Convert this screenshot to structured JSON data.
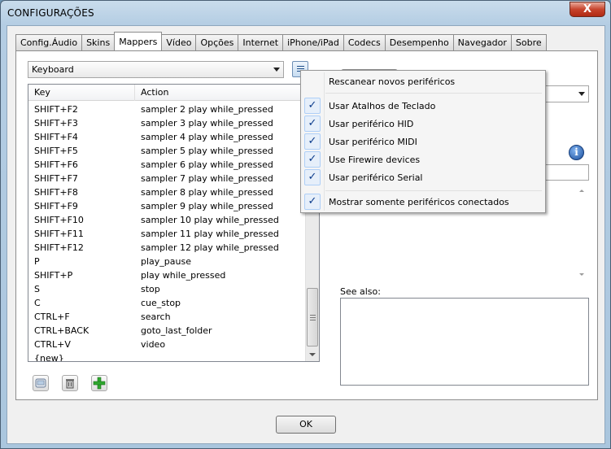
{
  "window": {
    "title": "CONFIGURAÇÕES",
    "close_symbol": "X"
  },
  "tabs": [
    "Config.Áudio",
    "Skins",
    "Mappers",
    "Vídeo",
    "Opções",
    "Internet",
    "iPhone/iPad",
    "Codecs",
    "Desempenho",
    "Navegador",
    "Sobre"
  ],
  "active_tab": "Mappers",
  "mapper_combo": {
    "value": "Keyboard"
  },
  "list": {
    "columns": {
      "key": "Key",
      "action": "Action"
    },
    "rows": [
      {
        "key": "SHIFT+F2",
        "action": "sampler 2 play while_pressed"
      },
      {
        "key": "SHIFT+F3",
        "action": "sampler 3 play while_pressed"
      },
      {
        "key": "SHIFT+F4",
        "action": "sampler 4 play while_pressed"
      },
      {
        "key": "SHIFT+F5",
        "action": "sampler 5 play while_pressed"
      },
      {
        "key": "SHIFT+F6",
        "action": "sampler 6 play while_pressed"
      },
      {
        "key": "SHIFT+F7",
        "action": "sampler 7 play while_pressed"
      },
      {
        "key": "SHIFT+F8",
        "action": "sampler 8 play while_pressed"
      },
      {
        "key": "SHIFT+F9",
        "action": "sampler 9 play while_pressed"
      },
      {
        "key": "SHIFT+F10",
        "action": "sampler 10 play while_pressed"
      },
      {
        "key": "SHIFT+F11",
        "action": "sampler 11 play while_pressed"
      },
      {
        "key": "SHIFT+F12",
        "action": "sampler 12 play while_pressed"
      },
      {
        "key": "P",
        "action": "play_pause"
      },
      {
        "key": "SHIFT+P",
        "action": "play while_pressed"
      },
      {
        "key": "S",
        "action": "stop"
      },
      {
        "key": "C",
        "action": "cue_stop"
      },
      {
        "key": "CTRL+F",
        "action": "search"
      },
      {
        "key": "CTRL+BACK",
        "action": "goto_last_folder"
      },
      {
        "key": "CTRL+V",
        "action": "video"
      },
      {
        "key": "{new}",
        "action": ""
      }
    ]
  },
  "right_panel": {
    "see_also_label": "See also:",
    "info_symbol": "i"
  },
  "popup_menu": {
    "check_symbol": "✓",
    "items": [
      {
        "label": "Rescanear novos periféricos",
        "checked": false
      },
      {
        "label": "Usar Atalhos de Teclado",
        "checked": true
      },
      {
        "label": "Usar periférico HID",
        "checked": true
      },
      {
        "label": "Usar periférico MIDI",
        "checked": true
      },
      {
        "label": "Use Firewire devices",
        "checked": true
      },
      {
        "label": "Usar periférico Serial",
        "checked": true
      },
      {
        "label": "Mostrar somente periféricos conectados",
        "checked": true
      }
    ]
  },
  "footer": {
    "ok_label": "OK"
  },
  "icons": [
    "keyboard-icon",
    "trash-icon",
    "add-icon",
    "menu-list-icon",
    "info-icon",
    "check-icon"
  ],
  "colors": {
    "add_green": "#2fa82f",
    "menu_check": "#0c3c8c"
  }
}
